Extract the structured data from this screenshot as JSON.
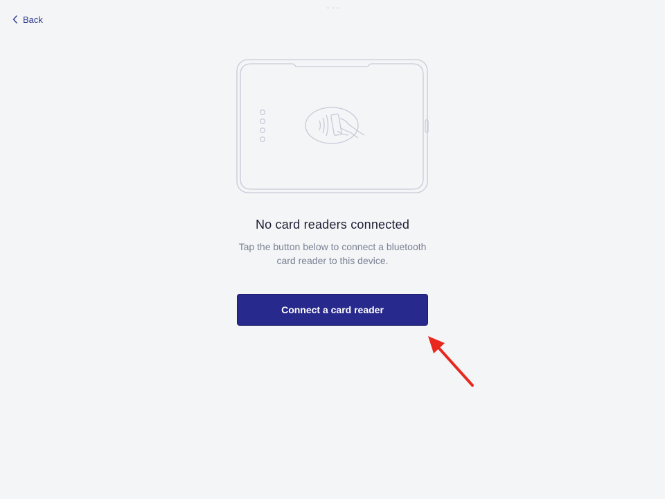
{
  "header": {
    "back_label": "Back"
  },
  "empty_state": {
    "illustration_icon": "card-reader-illustration",
    "title": "No card readers connected",
    "description": "Tap the button below to connect a bluetooth card reader to this device."
  },
  "actions": {
    "connect_label": "Connect a card reader"
  },
  "colors": {
    "background": "#f4f5f7",
    "primary": "#27298c",
    "link": "#2e3a8c",
    "title_text": "#1c1f33",
    "muted_text": "#7a8294",
    "illustration_stroke": "#c6cad8",
    "annotation_arrow": "#e8281e"
  }
}
